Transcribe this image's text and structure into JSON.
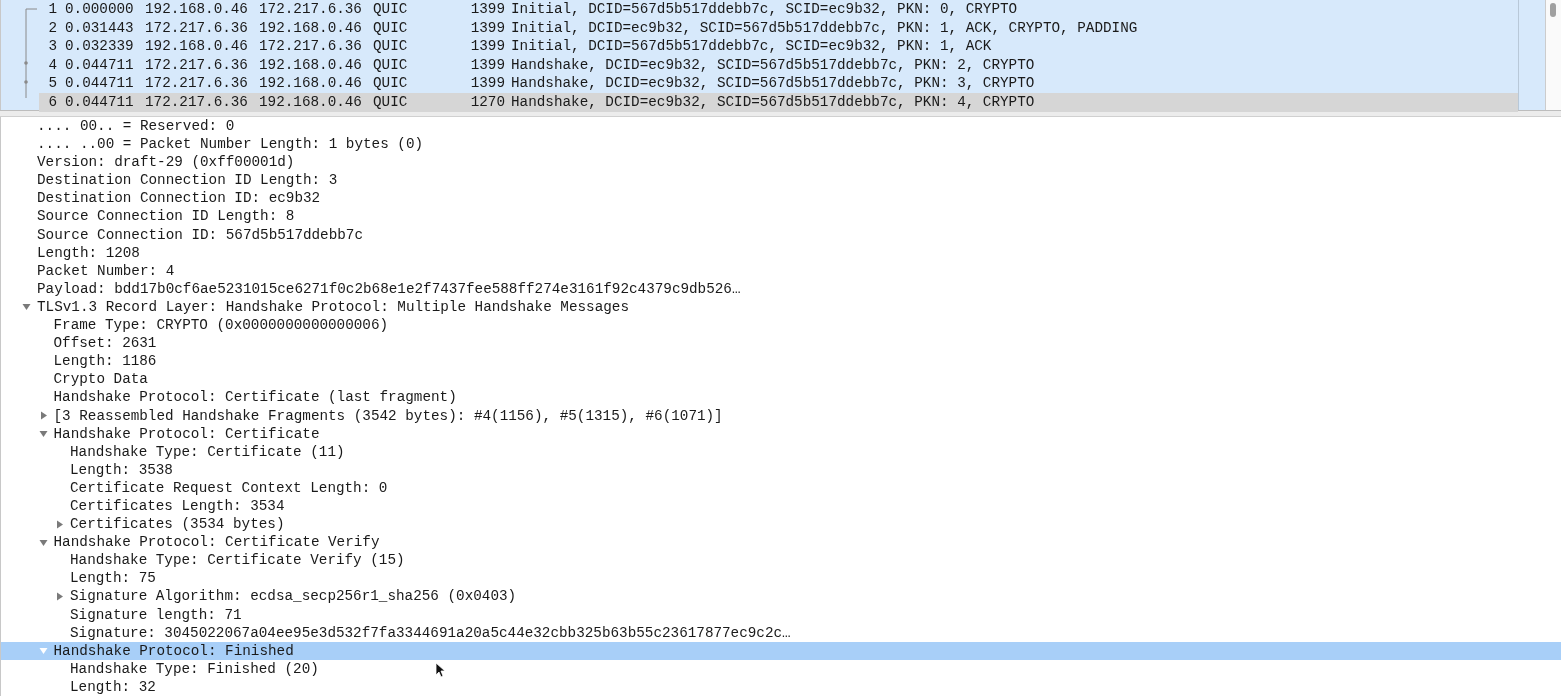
{
  "packet_list": {
    "rows": [
      {
        "no": "1",
        "time": "0.000000",
        "source": "192.168.0.46",
        "destination": "172.217.6.36",
        "protocol": "QUIC",
        "length": "1399",
        "info": "Initial, DCID=567d5b517ddebb7c, SCID=ec9b32, PKN: 0, CRYPTO",
        "selected": false
      },
      {
        "no": "2",
        "time": "0.031443",
        "source": "172.217.6.36",
        "destination": "192.168.0.46",
        "protocol": "QUIC",
        "length": "1399",
        "info": "Initial, DCID=ec9b32, SCID=567d5b517ddebb7c, PKN: 1, ACK, CRYPTO, PADDING",
        "selected": false
      },
      {
        "no": "3",
        "time": "0.032339",
        "source": "192.168.0.46",
        "destination": "172.217.6.36",
        "protocol": "QUIC",
        "length": "1399",
        "info": "Initial, DCID=567d5b517ddebb7c, SCID=ec9b32, PKN: 1, ACK",
        "selected": false
      },
      {
        "no": "4",
        "time": "0.044711",
        "source": "172.217.6.36",
        "destination": "192.168.0.46",
        "protocol": "QUIC",
        "length": "1399",
        "info": "Handshake, DCID=ec9b32, SCID=567d5b517ddebb7c, PKN: 2, CRYPTO",
        "selected": false
      },
      {
        "no": "5",
        "time": "0.044711",
        "source": "172.217.6.36",
        "destination": "192.168.0.46",
        "protocol": "QUIC",
        "length": "1399",
        "info": "Handshake, DCID=ec9b32, SCID=567d5b517ddebb7c, PKN: 3, CRYPTO",
        "selected": false
      },
      {
        "no": "6",
        "time": "0.044711",
        "source": "172.217.6.36",
        "destination": "192.168.0.46",
        "protocol": "QUIC",
        "length": "1270",
        "info": "Handshake, DCID=ec9b32, SCID=567d5b517ddebb7c, PKN: 4, CRYPTO",
        "selected": true
      }
    ]
  },
  "details": {
    "items": [
      {
        "text": ".... 00.. = Reserved: 0",
        "selected": false
      },
      {
        "text": ".... ..00 = Packet Number Length: 1 bytes (0)",
        "selected": false
      },
      {
        "text": "Version: draft-29 (0xff00001d)",
        "selected": false
      },
      {
        "text": "Destination Connection ID Length: 3",
        "selected": false
      },
      {
        "text": "Destination Connection ID: ec9b32",
        "selected": false
      },
      {
        "text": "Source Connection ID Length: 8",
        "selected": false
      },
      {
        "text": "Source Connection ID: 567d5b517ddebb7c",
        "selected": false
      },
      {
        "text": "Length: 1208",
        "selected": false
      },
      {
        "text": "Packet Number: 4",
        "selected": false
      },
      {
        "text": "Payload: bdd17b0cf6ae5231015ce6271f0c2b68e1e2f7437fee588ff274e3161f92c4379c9db526…",
        "selected": false
      },
      {
        "text": "TLSv1.3 Record Layer: Handshake Protocol: Multiple Handshake Messages",
        "selected": false,
        "expanded": true,
        "children": [
          {
            "text": "Frame Type: CRYPTO (0x0000000000000006)",
            "selected": false
          },
          {
            "text": "Offset: 2631",
            "selected": false
          },
          {
            "text": "Length: 1186",
            "selected": false
          },
          {
            "text": "Crypto Data",
            "selected": false
          },
          {
            "text": "Handshake Protocol: Certificate (last fragment)",
            "selected": false
          },
          {
            "text": "[3 Reassembled Handshake Fragments (3542 bytes): #4(1156), #5(1315), #6(1071)]",
            "selected": false,
            "expanded": false
          },
          {
            "text": "Handshake Protocol: Certificate",
            "selected": false,
            "expanded": true,
            "children": [
              {
                "text": "Handshake Type: Certificate (11)",
                "selected": false
              },
              {
                "text": "Length: 3538",
                "selected": false
              },
              {
                "text": "Certificate Request Context Length: 0",
                "selected": false
              },
              {
                "text": "Certificates Length: 3534",
                "selected": false
              },
              {
                "text": "Certificates (3534 bytes)",
                "selected": false,
                "expanded": false
              }
            ]
          },
          {
            "text": "Handshake Protocol: Certificate Verify",
            "selected": false,
            "expanded": true,
            "children": [
              {
                "text": "Handshake Type: Certificate Verify (15)",
                "selected": false
              },
              {
                "text": "Length: 75",
                "selected": false
              },
              {
                "text": "Signature Algorithm: ecdsa_secp256r1_sha256 (0x0403)",
                "selected": false,
                "expanded": false
              },
              {
                "text": "Signature length: 71",
                "selected": false
              },
              {
                "text": "Signature: 3045022067a04ee95e3d532f7fa3344691a20a5c44e32cbb325b63b55c23617877ec9c2c…",
                "selected": false
              }
            ]
          },
          {
            "text": "Handshake Protocol: Finished",
            "selected": true,
            "expanded": true,
            "children": [
              {
                "text": "Handshake Type: Finished (20)",
                "selected": false
              },
              {
                "text": "Length: 32",
                "selected": false
              }
            ]
          }
        ]
      }
    ]
  }
}
